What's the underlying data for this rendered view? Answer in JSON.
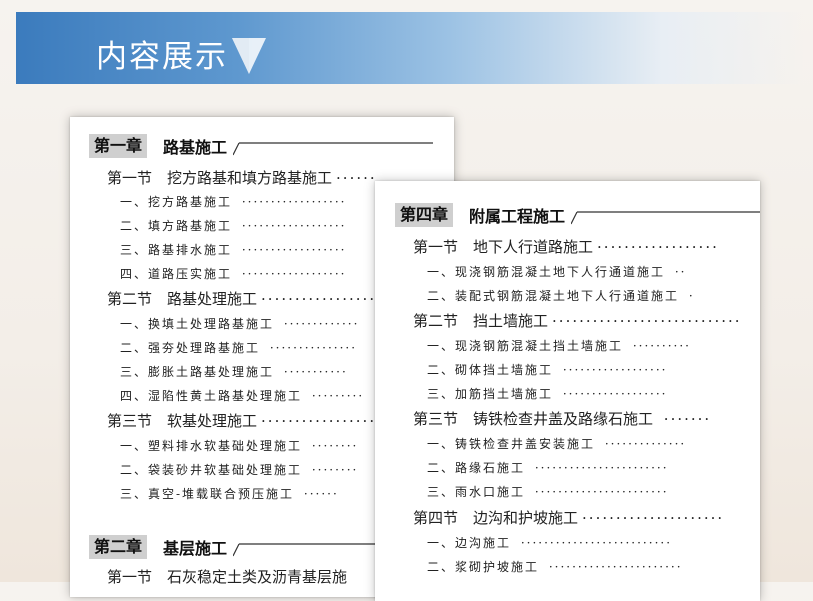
{
  "header": {
    "title": "内容展示"
  },
  "left_page": {
    "chapters": [
      {
        "label": "第一章",
        "title": "路基施工",
        "sections": [
          {
            "label": "第一节",
            "title": "挖方路基和填方路基施工",
            "items": [
              "一、挖方路基施工",
              "二、填方路基施工",
              "三、路基排水施工",
              "四、道路压实施工"
            ]
          },
          {
            "label": "第二节",
            "title": "路基处理施工",
            "items": [
              "一、换填土处理路基施工",
              "二、强夯处理路基施工",
              "三、膨胀土路基处理施工",
              "四、湿陷性黄土路基处理施工"
            ]
          },
          {
            "label": "第三节",
            "title": "软基处理施工",
            "items": [
              "一、塑料排水软基础处理施工",
              "二、袋装砂井软基础处理施工",
              "三、真空-堆载联合预压施工"
            ]
          }
        ]
      },
      {
        "label": "第二章",
        "title": "基层施工",
        "sections": [
          {
            "label": "第一节",
            "title": "石灰稳定土类及沥青基层施",
            "items": []
          }
        ]
      }
    ]
  },
  "right_page": {
    "chapters": [
      {
        "label": "第四章",
        "title": "附属工程施工",
        "sections": [
          {
            "label": "第一节",
            "title": "地下人行道路施工",
            "items": [
              "一、现浇钢筋混凝土地下人行通道施工",
              "二、装配式钢筋混凝土地下人行通道施工"
            ]
          },
          {
            "label": "第二节",
            "title": "挡土墙施工",
            "items": [
              "一、现浇钢筋混凝土挡土墙施工",
              "二、砌体挡土墙施工",
              "三、加筋挡土墙施工"
            ]
          },
          {
            "label": "第三节",
            "title": "铸铁检查井盖及路缘石施工",
            "items": [
              "一、铸铁检查井盖安装施工",
              "二、路缘石施工",
              "三、雨水口施工"
            ]
          },
          {
            "label": "第四节",
            "title": "边沟和护坡施工",
            "items": [
              "一、边沟施工",
              "二、浆砌护坡施工"
            ]
          }
        ]
      }
    ]
  },
  "colors": {
    "banner_start": "#3b7bbd",
    "badge_bg": "#cfcfcf",
    "text": "#222222",
    "arrow": "#ffffff"
  },
  "icons": {
    "banner_arrow": "down-arrow-icon"
  }
}
